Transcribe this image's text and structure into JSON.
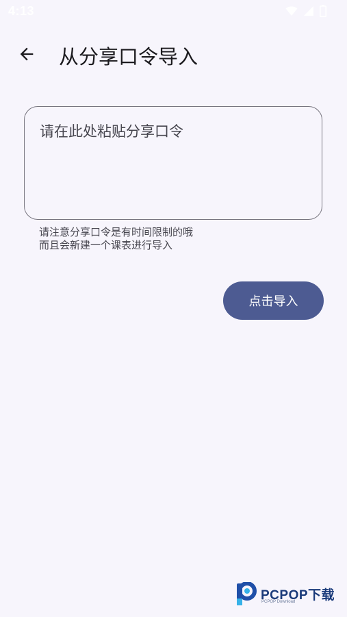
{
  "status_bar": {
    "time": "4:13",
    "icons": [
      "wifi-icon",
      "signal-icon",
      "battery-icon"
    ]
  },
  "app_bar": {
    "back_icon": "arrow-back-icon",
    "title": "从分享口令导入"
  },
  "share_input": {
    "placeholder": "请在此处粘贴分享口令",
    "value": ""
  },
  "helper_text": {
    "line1": "请注意分享口令是有时间限制的哦",
    "line2": "而且会新建一个课表进行导入"
  },
  "import_button": {
    "label": "点击导入"
  },
  "watermark": {
    "brand": "PCPOP下载",
    "subtitle": "PCPOP Download"
  },
  "colors": {
    "background": "#f7f5fc",
    "primary": "#4d5b92",
    "text": "#1c1b1f",
    "outline": "#77757f"
  }
}
